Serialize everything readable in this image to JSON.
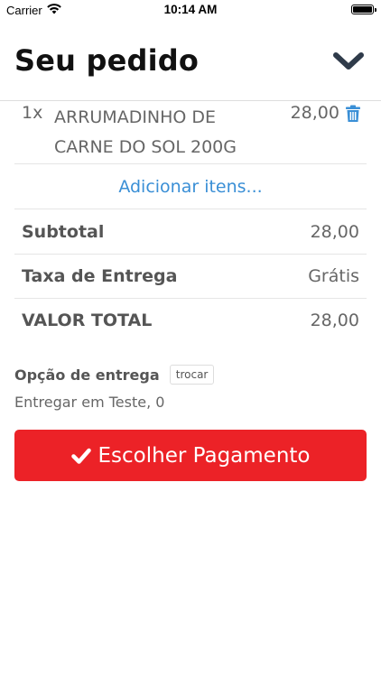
{
  "status_bar": {
    "carrier": "Carrier",
    "time": "10:14 AM"
  },
  "header": {
    "title": "Seu pedido",
    "collapse_icon": "chevron-down-icon"
  },
  "order": {
    "items": [
      {
        "quantity": "1x",
        "name": "ARRUMADINHO DE CARNE DO SOL 200G",
        "price": "28,00",
        "remove_icon": "trash-icon"
      }
    ],
    "add_items_label": "Adicionar itens..."
  },
  "summary": {
    "subtotal_label": "Subtotal",
    "subtotal_value": "28,00",
    "delivery_fee_label": "Taxa de Entrega",
    "delivery_fee_value": "Grátis",
    "total_label": "VALOR TOTAL",
    "total_value": "28,00"
  },
  "delivery": {
    "title": "Opção de entrega",
    "change_label": "trocar",
    "address": "Entregar em Teste, 0"
  },
  "actions": {
    "pay_label": "Escolher Pagamento",
    "pay_icon": "check-icon"
  },
  "colors": {
    "accent_red": "#ec2227",
    "link_blue": "#3a8fd6",
    "trash_blue": "#3a8fd6"
  }
}
